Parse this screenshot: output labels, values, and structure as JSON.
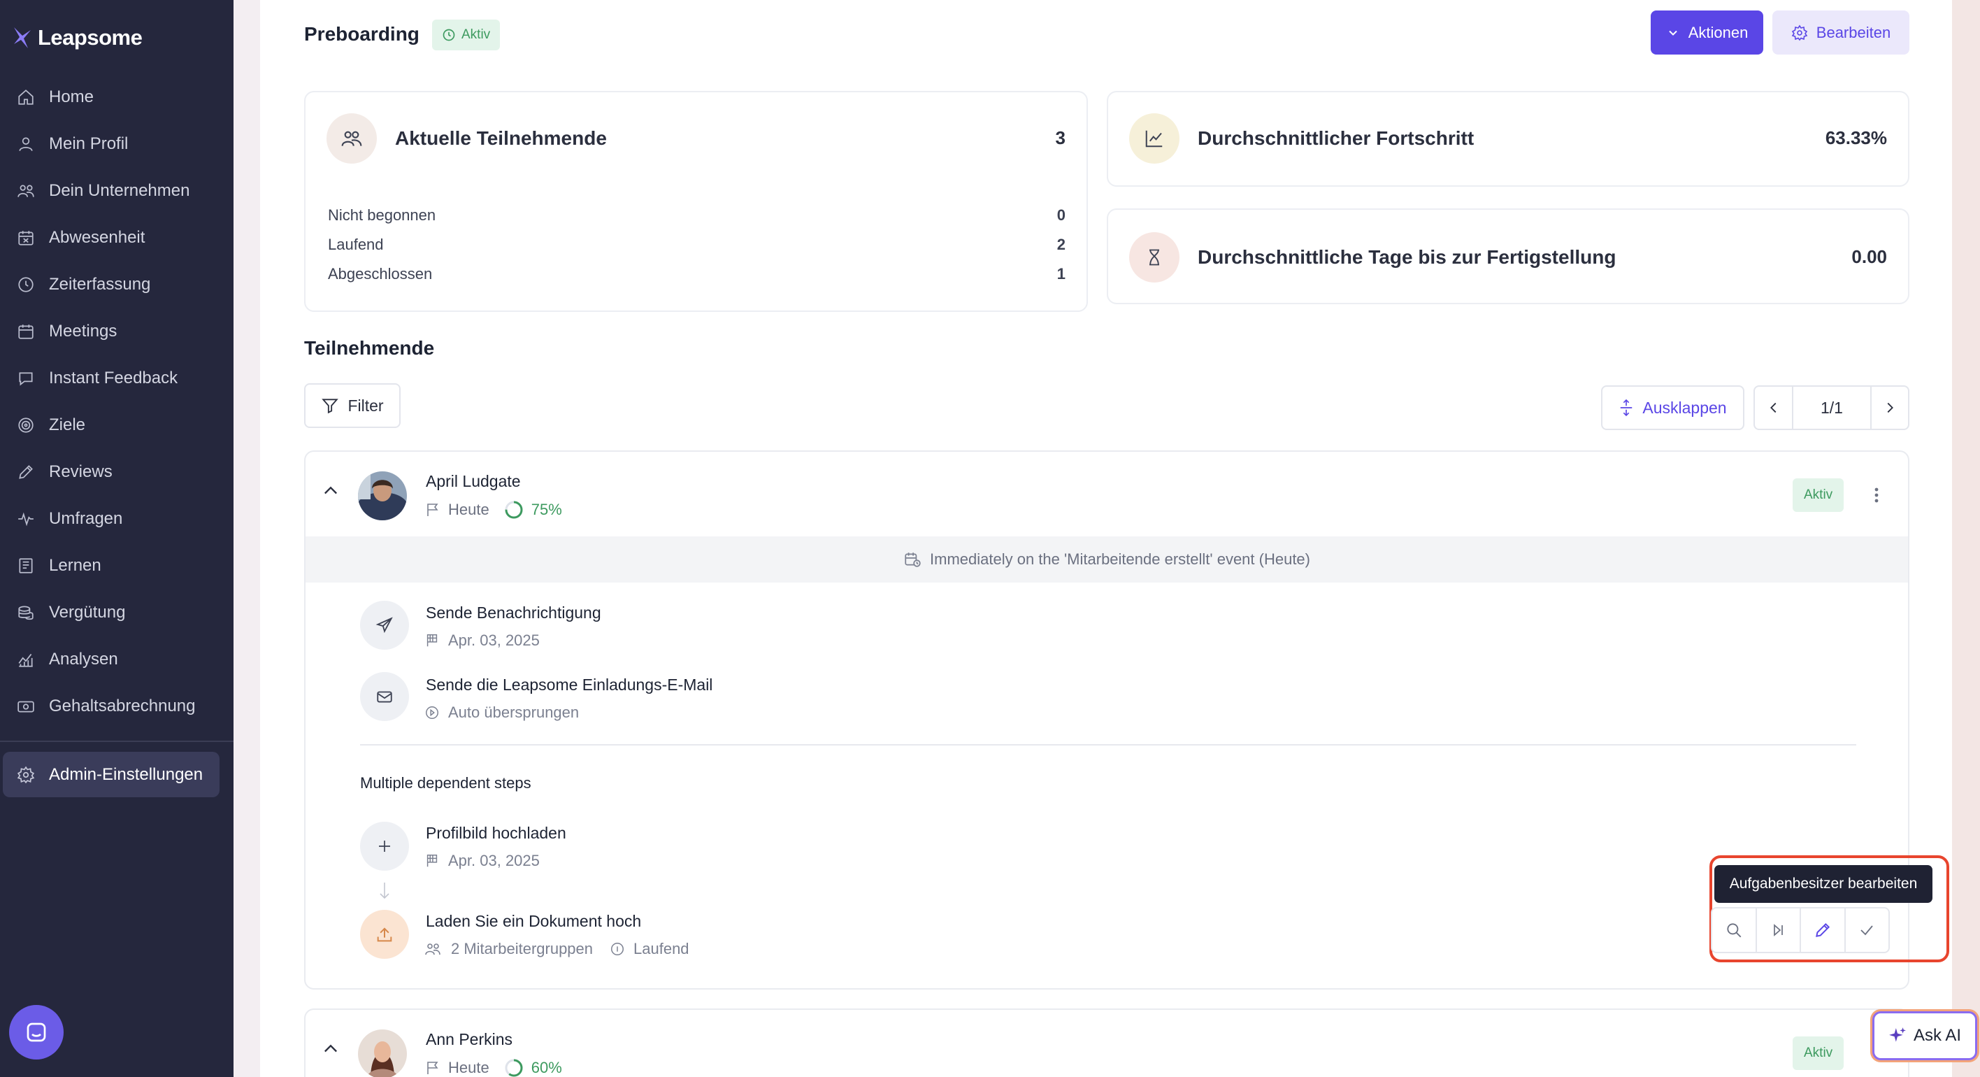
{
  "app": {
    "name": "Leapsome"
  },
  "sidebar": {
    "items": [
      {
        "label": "Home",
        "icon": "home-icon"
      },
      {
        "label": "Mein Profil",
        "icon": "user-icon"
      },
      {
        "label": "Dein Unternehmen",
        "icon": "users-icon"
      },
      {
        "label": "Abwesenheit",
        "icon": "calendar-x-icon"
      },
      {
        "label": "Zeiterfassung",
        "icon": "clock-icon"
      },
      {
        "label": "Meetings",
        "icon": "calendar-icon"
      },
      {
        "label": "Instant Feedback",
        "icon": "chat-icon"
      },
      {
        "label": "Ziele",
        "icon": "target-icon"
      },
      {
        "label": "Reviews",
        "icon": "pen-icon"
      },
      {
        "label": "Umfragen",
        "icon": "pulse-icon"
      },
      {
        "label": "Lernen",
        "icon": "book-icon"
      },
      {
        "label": "Vergütung",
        "icon": "coins-icon"
      },
      {
        "label": "Analysen",
        "icon": "chart-icon"
      },
      {
        "label": "Gehaltsabrechnung",
        "icon": "money-icon"
      }
    ],
    "admin": {
      "label": "Admin-Einstellungen",
      "icon": "gear-icon"
    }
  },
  "header": {
    "title": "Preboarding",
    "status": "Aktiv",
    "actions_label": "Aktionen",
    "edit_label": "Bearbeiten"
  },
  "stats": {
    "participants": {
      "title": "Aktuelle Teilnehmende",
      "value": "3",
      "rows": [
        {
          "label": "Nicht begonnen",
          "value": "0"
        },
        {
          "label": "Laufend",
          "value": "2"
        },
        {
          "label": "Abgeschlossen",
          "value": "1"
        }
      ]
    },
    "progress": {
      "title": "Durchschnittlicher Fortschritt",
      "value": "63.33%"
    },
    "days": {
      "title": "Durchschnittliche Tage bis zur Fertigstellung",
      "value": "0.00"
    }
  },
  "participants_section": {
    "title": "Teilnehmende",
    "filter_label": "Filter",
    "expand_label": "Ausklappen",
    "pagination": "1/1"
  },
  "participants": [
    {
      "name": "April Ludgate",
      "date": "Heute",
      "progress": "75%",
      "progress_fraction": 0.75,
      "status": "Aktiv",
      "event": "Immediately on the 'Mitarbeitende erstellt' event (Heute)",
      "steps": [
        {
          "title": "Sende Benachrichtigung",
          "meta": "Apr. 03, 2025"
        },
        {
          "title": "Sende die Leapsome Einladungs-E-Mail",
          "meta": "Auto übersprungen"
        }
      ],
      "group_title": "Multiple dependent steps",
      "group_steps": [
        {
          "title": "Profilbild hochladen",
          "meta": "Apr. 03, 2025"
        },
        {
          "title": "Laden Sie ein Dokument hoch",
          "meta": "2 Mitarbeitergruppen",
          "status": "Laufend"
        }
      ]
    },
    {
      "name": "Ann Perkins",
      "date": "Heute",
      "progress": "60%",
      "progress_fraction": 0.6,
      "status": "Aktiv"
    }
  ],
  "tooltip": "Aufgabenbesitzer bearbeiten",
  "ask_ai": "Ask AI",
  "colors": {
    "sidebar": "#25273d",
    "accent": "#5a46e6",
    "success": "#3d9a5f",
    "highlight": "#e8452e"
  }
}
